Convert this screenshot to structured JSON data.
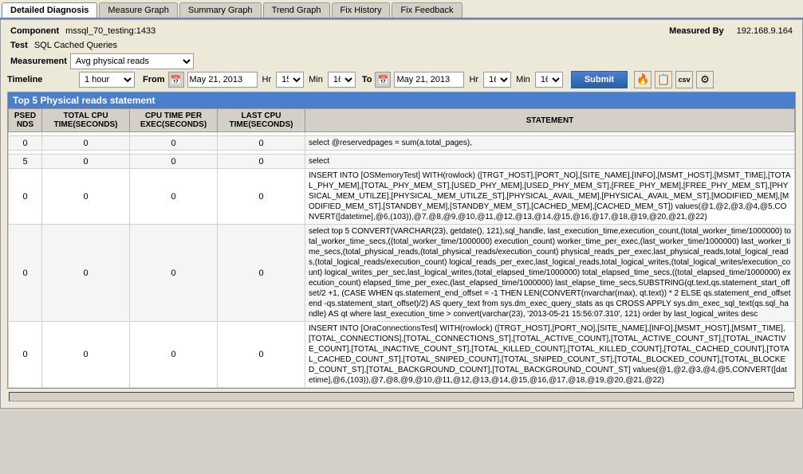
{
  "tabs": [
    {
      "id": "detailed-diagnosis",
      "label": "Detailed Diagnosis",
      "active": true
    },
    {
      "id": "measure-graph",
      "label": "Measure Graph",
      "active": false
    },
    {
      "id": "summary-graph",
      "label": "Summary Graph",
      "active": false
    },
    {
      "id": "trend-graph",
      "label": "Trend Graph",
      "active": false
    },
    {
      "id": "fix-history",
      "label": "Fix History",
      "active": false
    },
    {
      "id": "fix-feedback",
      "label": "Fix Feedback",
      "active": false
    }
  ],
  "info": {
    "component_label": "Component",
    "component_value": "mssql_70_testing:1433",
    "measured_by_label": "Measured By",
    "measured_by_value": "192.168.9.164",
    "test_label": "Test",
    "test_value": "SQL Cached Queries",
    "measurement_label": "Measurement",
    "measurement_value": "Avg physical reads",
    "timeline_label": "Timeline",
    "timeline_value": "1 hour",
    "from_label": "From",
    "date_from": "May 21, 2013",
    "hr_from": "15",
    "min_from": "16",
    "to_label": "To",
    "date_to": "May 21, 2013",
    "hr_to": "16",
    "min_to": "16",
    "submit_label": "Submit"
  },
  "table": {
    "title": "Top 5 Physical reads statement",
    "headers": [
      "PSED\nNDS",
      "TOTAL CPU\nTIME(SECONDS)",
      "CPU TIME PER\nEXEC(SECONDS)",
      "LAST CPU\nTIME(SECONDS)",
      "STATEMENT"
    ],
    "rows": [
      {
        "psed": "",
        "total_cpu": "",
        "cpu_per": "",
        "last_cpu": "",
        "statement": ""
      },
      {
        "psed": "0",
        "total_cpu": "0",
        "cpu_per": "0",
        "last_cpu": "0",
        "statement": "select @reservedpages = sum(a.total_pages),"
      },
      {
        "psed": "",
        "total_cpu": "",
        "cpu_per": "",
        "last_cpu": "",
        "statement": ""
      },
      {
        "psed": "5",
        "total_cpu": "0",
        "cpu_per": "0",
        "last_cpu": "0",
        "statement": "select"
      },
      {
        "psed": "0",
        "total_cpu": "0",
        "cpu_per": "0",
        "last_cpu": "0",
        "statement": "INSERT INTO [OSMemoryTest] WITH(rowlock) ([TRGT_HOST],[PORT_NO],[SITE_NAME],[INFO],[MSMT_HOST],[MSMT_TIME],[TOTAL_PHY_MEM],[TOTAL_PHY_MEM_ST],[USED_PHY_MEM],[USED_PHY_MEM_ST],[FREE_PHY_MEM],[FREE_PHY_MEM_ST],[PHYSICAL_MEM_UTILZE],[PHYSICAL_MEM_UTILZE_ST],[PHYSICAL_AVAIL_MEM],[PHYSICAL_AVAIL_MEM_ST],[MODIFIED_MEM],[MODIFIED_MEM_ST],[STANDBY_MEM],[STANDBY_MEM_ST],[CACHED_MEM],[CACHED_MEM_ST]) values(@1,@2,@3,@4,@5,CONVERT([datetime],@6,(103)),@7,@8,@9,@10,@11,@12,@13,@14,@15,@16,@17,@18,@19,@20,@21,@22)"
      },
      {
        "psed": "0",
        "total_cpu": "0",
        "cpu_per": "0",
        "last_cpu": "0",
        "statement": "select top 5 CONVERT(VARCHAR(23), getdate(), 121),sql_handle, last_execution_time,execution_count,(total_worker_time/1000000) total_worker_time_secs,((total_worker_time/1000000) execution_count) worker_time_per_exec,(last_worker_time/1000000) last_worker_time_secs,(total_physical_reads,(total_physical_reads/execution_count) physical_reads_per_exec,last_physical_reads,total_logical_reads,(total_logical_reads/execution_count) logical_reads_per_exec,last_logical_reads,total_logical_writes,(total_logical_writes/execution_count) logical_writes_per_sec,last_logical_writes,(total_elapsed_time/1000000) total_elapsed_time_secs,((total_elapsed_time/1000000) execution_count) elapsed_time_per_exec,(last_elapsed_time/1000000) last_elapse_time_secs,SUBSTRING(qt.text,qs.statement_start_offset/2 +1, (CASE WHEN qs.statement_end_offset = -1 THEN LEN(CONVERT(nvarchar(max), qt.text)) * 2 ELSE qs.statement_end_offset end -qs.statement_start_offset)/2) AS query_text from sys.dm_exec_query_stats as qs CROSS APPLY sys.dm_exec_sql_text(qs.sql_handle) AS qt where last_execution_time > convert(varchar(23), '2013-05-21 15:56:07.310', 121) order by last_logical_writes desc"
      },
      {
        "psed": "0",
        "total_cpu": "0",
        "cpu_per": "0",
        "last_cpu": "0",
        "statement": "INSERT INTO [OraConnectionsTest] WITH(rowlock) ([TRGT_HOST],[PORT_NO],[SITE_NAME],[INFO],[MSMT_HOST],[MSMT_TIME],[TOTAL_CONNECTIONS],[TOTAL_CONNECTIONS_ST],[TOTAL_ACTIVE_COUNT],[TOTAL_ACTIVE_COUNT_ST],[TOTAL_INACTIVE_COUNT],[TOTAL_INACTIVE_COUNT_ST],[TOTAL_KILLED_COUNT],[TOTAL_KILLED_COUNT],[TOTAL_CACHED_COUNT],[TOTAL_CACHED_COUNT_ST],[TOTAL_SNIPED_COUNT],[TOTAL_SNIPED_COUNT_ST],[TOTAL_BLOCKED_COUNT],[TOTAL_BLOCKED_COUNT_ST],[TOTAL_BACKGROUND_COUNT],[TOTAL_BACKGROUND_COUNT_ST] values(@1,@2,@3,@4,@5,CONVERT([datetime],@6,(103)),@7,@8,@9,@10,@11,@12,@13,@14,@15,@16,@17,@18,@19,@20,@21,@22)"
      }
    ]
  },
  "icons": {
    "fire": "🔥",
    "copy": "📋",
    "csv": "csv",
    "settings": "⚙"
  }
}
